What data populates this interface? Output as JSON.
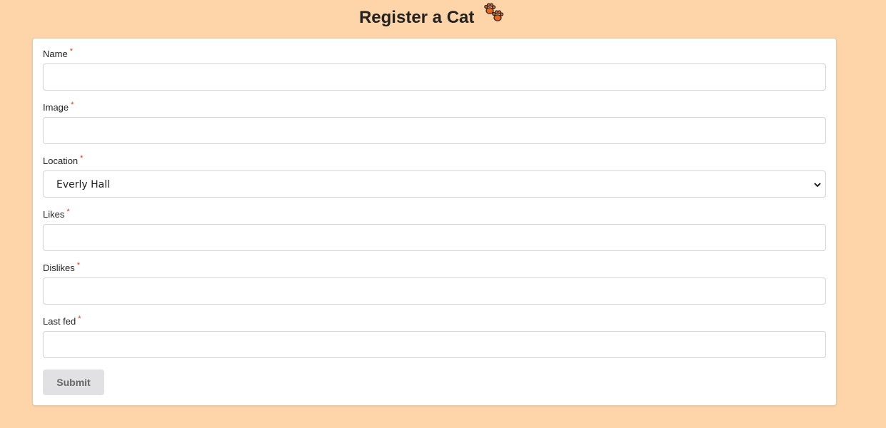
{
  "page": {
    "title": "Register a Cat"
  },
  "form": {
    "fields": [
      {
        "label": "Name",
        "required_mark": "*",
        "value": ""
      },
      {
        "label": "Image",
        "required_mark": "*",
        "value": ""
      },
      {
        "label": "Location",
        "required_mark": "*",
        "value": "Everly Hall"
      },
      {
        "label": "Likes",
        "required_mark": "*",
        "value": ""
      },
      {
        "label": "Dislikes",
        "required_mark": "*",
        "value": ""
      },
      {
        "label": "Last fed",
        "required_mark": "*",
        "value": ""
      }
    ],
    "submit_label": "Submit"
  },
  "colors": {
    "background": "#fed5a8",
    "required": "#d9381e",
    "paw": "#e8641b",
    "button_bg": "#e1e1e3"
  },
  "icons": [
    "paw-prints-icon",
    "chevron-down-icon"
  ]
}
